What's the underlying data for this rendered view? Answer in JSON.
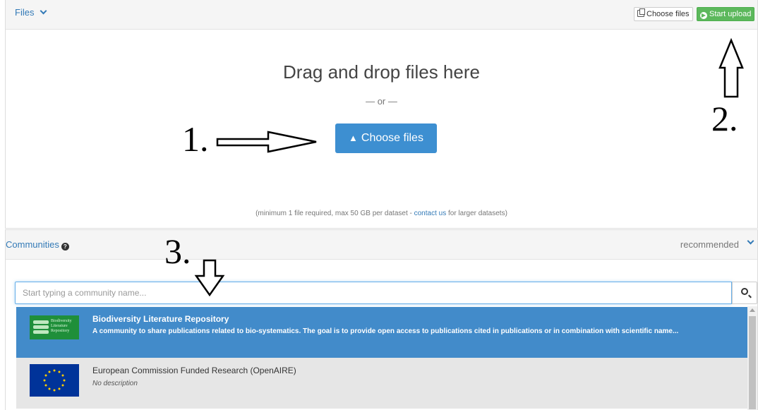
{
  "files": {
    "title": "Files",
    "header_choose_label": "Choose files",
    "header_start_label": "Start upload",
    "drop_title": "Drag and drop files here",
    "or_text": "— or —",
    "choose_button_label": "Choose files",
    "note_before": "(minimum 1 file required, max 50 GB per dataset - ",
    "note_link": "contact us",
    "note_after": " for larger datasets)"
  },
  "communities": {
    "title": "Communities",
    "recommended_label": "recommended",
    "search_placeholder": "Start typing a community name...",
    "items": [
      {
        "title": "Biodiversity Literature Repository",
        "description": "A community to share publications related to bio-systematics. The goal is to provide open access to publications cited in publications or in combination with scientific name...",
        "logo_text": "Biodiversity Literature Repository",
        "selected": true
      },
      {
        "title": "European Commission Funded Research (OpenAIRE)",
        "description": "No description",
        "selected": false
      }
    ]
  },
  "annotations": {
    "step1": "1.",
    "step2": "2.",
    "step3": "3."
  },
  "colors": {
    "primary": "#3d8fd1",
    "success": "#5cb85c",
    "selected_row": "#428bca",
    "link": "#337ab7"
  }
}
